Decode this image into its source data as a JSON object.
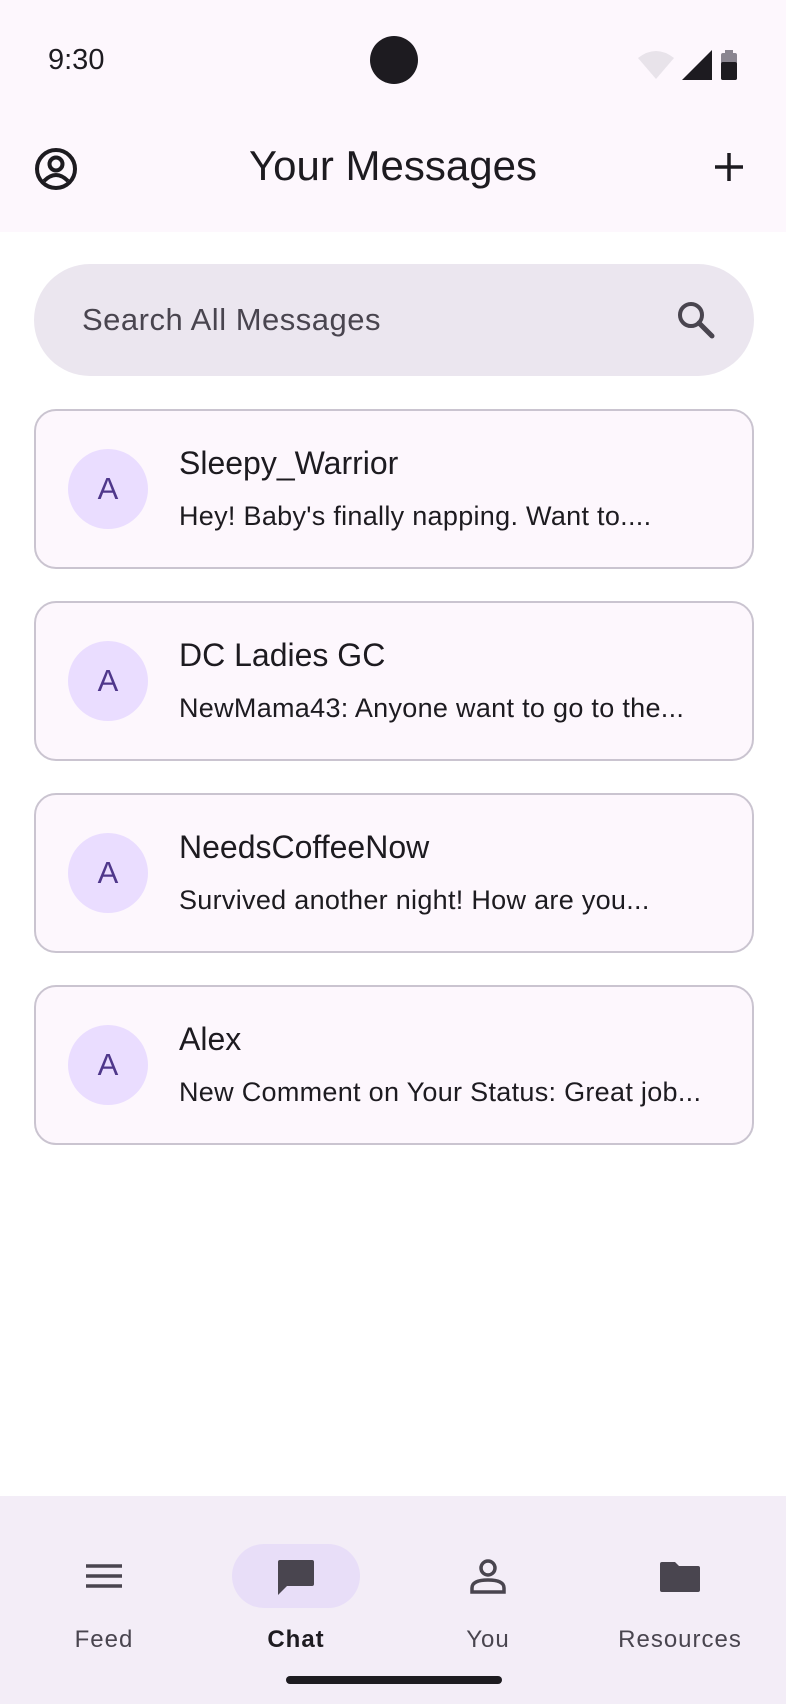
{
  "status_bar": {
    "time": "9:30"
  },
  "app_bar": {
    "title": "Your Messages"
  },
  "search": {
    "placeholder": "Search All Messages"
  },
  "conversations": [
    {
      "avatar_letter": "A",
      "name": "Sleepy_Warrior",
      "preview": "Hey! Baby's finally napping. Want to...."
    },
    {
      "avatar_letter": "A",
      "name": "DC Ladies GC",
      "preview": "NewMama43: Anyone want to go to the..."
    },
    {
      "avatar_letter": "A",
      "name": "NeedsCoffeeNow",
      "preview": "Survived another night! How are you..."
    },
    {
      "avatar_letter": "A",
      "name": "Alex",
      "preview": "New Comment on Your Status: Great job..."
    }
  ],
  "bottom_nav": {
    "items": [
      {
        "label": "Feed",
        "icon": "menu-icon",
        "active": false
      },
      {
        "label": "Chat",
        "icon": "chat-icon",
        "active": true
      },
      {
        "label": "You",
        "icon": "person-icon",
        "active": false
      },
      {
        "label": "Resources",
        "icon": "folder-icon",
        "active": false
      }
    ]
  },
  "colors": {
    "surface": "#fdf7fd",
    "avatar_bg": "#eaddff",
    "avatar_text": "#4f378b",
    "search_bg": "#ebe6ef",
    "nav_bg": "#f3edf7",
    "nav_active": "#e8def8"
  }
}
